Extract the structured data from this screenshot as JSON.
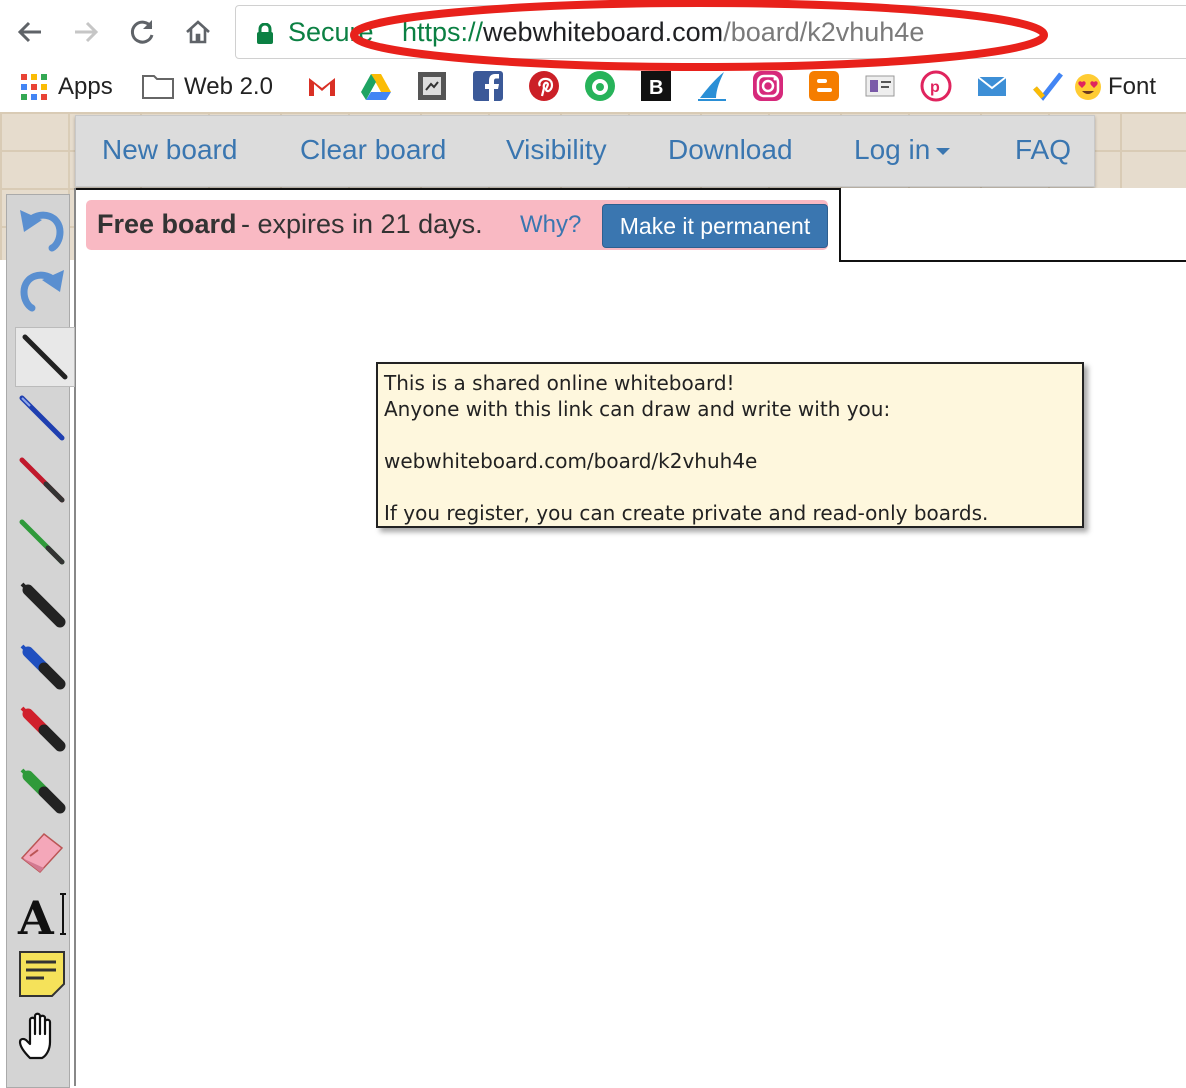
{
  "browser": {
    "secure_label": "Secure",
    "url_scheme": "https://",
    "url_host": "webwhiteboard.com",
    "url_path": "/board/k2vhuh4e"
  },
  "bookmarks": {
    "apps_label": "Apps",
    "folder_label": "Web 2.0",
    "font_label": "Font"
  },
  "menu": {
    "new_board": "New board",
    "clear_board": "Clear board",
    "visibility": "Visibility",
    "download": "Download",
    "log_in": "Log in",
    "faq": "FAQ"
  },
  "alert": {
    "strong": "Free board",
    "text": "- expires in 21 days.",
    "why": "Why?",
    "button": "Make it permanent"
  },
  "tooltip": {
    "line1": "This is a shared online whiteboard!",
    "line2": "Anyone with this link can draw and write with you:",
    "line3": "webwhiteboard.com/board/k2vhuh4e",
    "line4": "If you register, you can create private and read-only boards."
  },
  "tools": [
    "undo-icon",
    "redo-icon",
    "black-pen-icon",
    "blue-pen-icon",
    "red-pen-icon",
    "green-pen-icon",
    "black-marker-icon",
    "blue-marker-icon",
    "red-marker-icon",
    "green-marker-icon",
    "eraser-icon",
    "text-tool-icon",
    "sticky-note-icon",
    "hand-pan-icon"
  ],
  "colors": {
    "secure_green": "#0b8043",
    "link_blue": "#3a76b0",
    "alert_pink": "#f9b9c3",
    "annotation_red": "#e8211b",
    "tooltip_bg": "#fef7dd"
  }
}
